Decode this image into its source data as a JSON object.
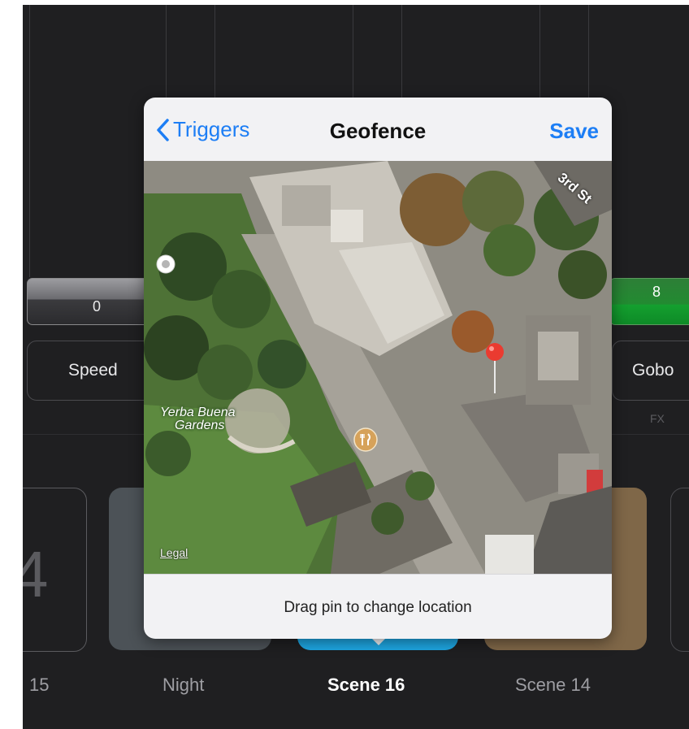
{
  "background": {
    "slider_left_value": "0",
    "slider_right_value": "8",
    "speed_label": "Speed",
    "gobo_label": "Gobo",
    "fx_label": "FX",
    "tile_left_number": "4",
    "scene_labels": [
      "15",
      "Night",
      "Scene 16",
      "Scene 14"
    ],
    "colors": {
      "selected_scene": "#1ea7e3",
      "night_tile": "#4c5257",
      "scene14_tile": "#7f6748",
      "slider_green": "#228b31"
    }
  },
  "popover": {
    "back_label": "Triggers",
    "title": "Geofence",
    "save_label": "Save",
    "footer_hint": "Drag pin to change location",
    "accent": "#1d7ef5",
    "map": {
      "place_label_line1": "Yerba Buena",
      "place_label_line2": "Gardens",
      "street_label": "3rd St",
      "legal_link": "Legal",
      "icons": [
        "location-pin-icon",
        "restaurant-icon",
        "user-location-icon"
      ]
    }
  }
}
